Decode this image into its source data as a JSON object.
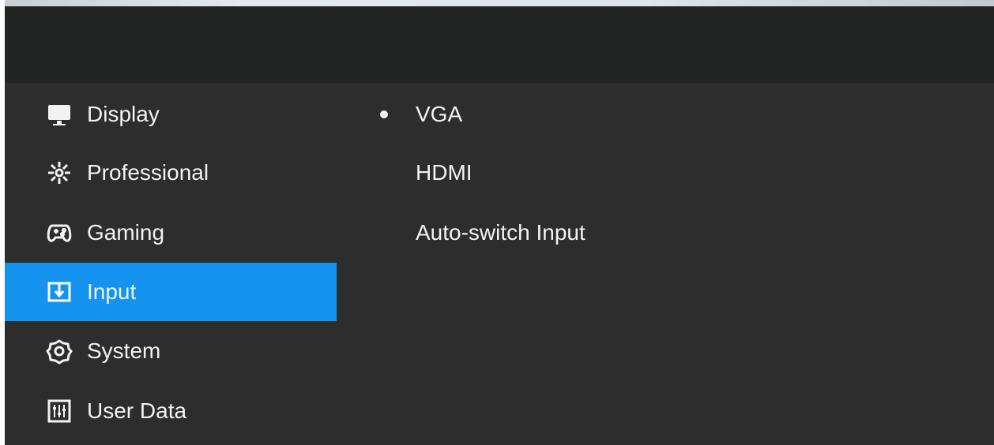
{
  "sidebar": {
    "items": [
      {
        "label": "Display",
        "icon": "monitor-icon",
        "active": false
      },
      {
        "label": "Professional",
        "icon": "snowflake-icon",
        "active": false
      },
      {
        "label": "Gaming",
        "icon": "gamepad-icon",
        "active": false
      },
      {
        "label": "Input",
        "icon": "input-icon",
        "active": true
      },
      {
        "label": "System",
        "icon": "gear-icon",
        "active": false
      },
      {
        "label": "User Data",
        "icon": "sliders-icon",
        "active": false
      }
    ]
  },
  "input_options": {
    "items": [
      {
        "label": "VGA",
        "selected": true
      },
      {
        "label": "HDMI",
        "selected": false
      },
      {
        "label": "Auto-switch Input",
        "selected": false
      }
    ]
  },
  "colors": {
    "background": "#2d2d2d",
    "header": "#222524",
    "active": "#1494ee",
    "text": "#f2f2f2"
  }
}
